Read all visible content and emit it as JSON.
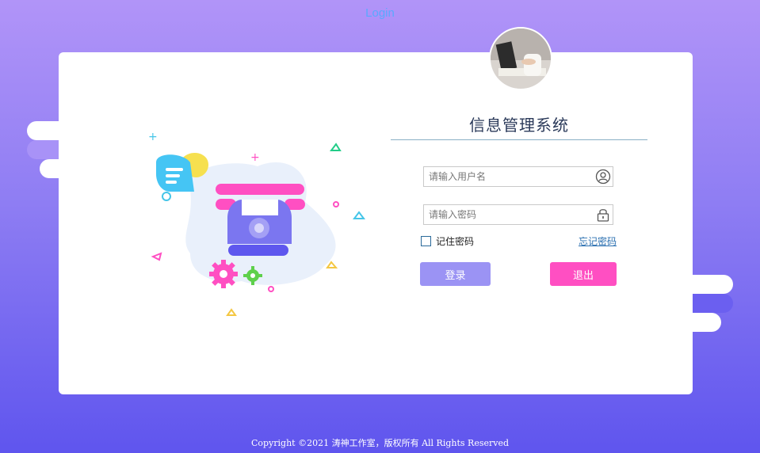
{
  "page": {
    "tab_title": "Login"
  },
  "system": {
    "title": "信息管理系统"
  },
  "form": {
    "username_placeholder": "请输入用户名",
    "password_placeholder": "请输入密码",
    "remember_label": "记住密码",
    "forgot_label": "忘记密码",
    "login_label": "登录",
    "exit_label": "退出"
  },
  "footer": {
    "copyright": "Copyright ©2021 涛神工作室，版权所有 All Rights Reserved"
  },
  "icons": {
    "user": "user-icon",
    "lock": "lock-icon",
    "phone": "telephone-illustration"
  },
  "colors": {
    "accent": "#9b93f4",
    "exit": "#ff4fc2",
    "background_top": "#b194f8",
    "background_bottom": "#5f55ee"
  }
}
